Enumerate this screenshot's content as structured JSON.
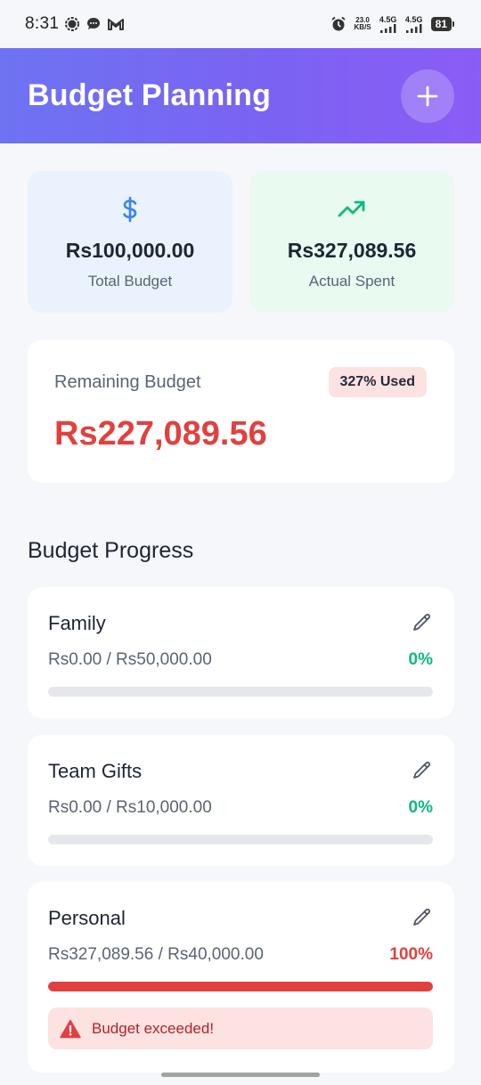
{
  "status_bar": {
    "time": "8:31",
    "net_speed_value": "23.0",
    "net_speed_unit": "KB/S",
    "sim1_label": "4.5G",
    "sim2_label": "4.5G",
    "battery": "81"
  },
  "header": {
    "title": "Budget Planning",
    "add_icon": "plus-icon"
  },
  "summary": {
    "total_budget": {
      "icon": "dollar-icon",
      "value": "Rs100,000.00",
      "label": "Total Budget",
      "accent": "#3b82f6"
    },
    "actual_spent": {
      "icon": "trending-up-icon",
      "value": "Rs327,089.56",
      "label": "Actual Spent",
      "accent": "#10b981"
    }
  },
  "remaining": {
    "label": "Remaining Budget",
    "badge": "327% Used",
    "value": "Rs227,089.56",
    "value_color": "#e0413f"
  },
  "progress_section": {
    "title": "Budget Progress",
    "items": [
      {
        "name": "Family",
        "amounts": "Rs0.00 / Rs50,000.00",
        "percent": "0%",
        "progress": 0,
        "percent_color": "#10b981"
      },
      {
        "name": "Team Gifts",
        "amounts": "Rs0.00 / Rs10,000.00",
        "percent": "0%",
        "progress": 0,
        "percent_color": "#10b981"
      },
      {
        "name": "Personal",
        "amounts": "Rs327,089.56 / Rs40,000.00",
        "percent": "100%",
        "progress": 1,
        "percent_color": "#e0413f",
        "alert": "Budget exceeded!"
      }
    ]
  },
  "colors": {
    "header_gradient_start": "#6e73f2",
    "header_gradient_end": "#8b5cf6",
    "danger": "#e0413f",
    "success": "#10b981"
  }
}
